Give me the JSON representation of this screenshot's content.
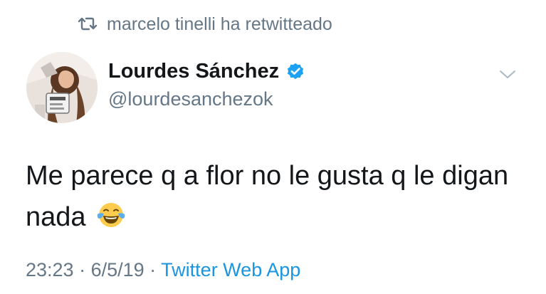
{
  "retweet": {
    "icon": "retweet-icon",
    "text": "marcelo tinelli ha retwitteado"
  },
  "author": {
    "name": "Lourdes Sánchez",
    "handle": "@lourdesanchezok",
    "verified": true,
    "verified_icon": "verified-badge-icon",
    "avatar": "avatar-photo"
  },
  "menu": {
    "icon": "chevron-down-icon"
  },
  "tweet": {
    "line1": "Me parece q a flor no le gusta q le digan",
    "line2": "nada",
    "emoji": "face-with-tears-of-joy-emoji"
  },
  "meta": {
    "time": "23:23",
    "sep1": " · ",
    "date": "6/5/19",
    "sep2": " · ",
    "source": "Twitter Web App"
  },
  "colors": {
    "text": "#14171a",
    "secondary": "#657786",
    "link": "#1b95e0",
    "verified": "#1da1f2"
  }
}
